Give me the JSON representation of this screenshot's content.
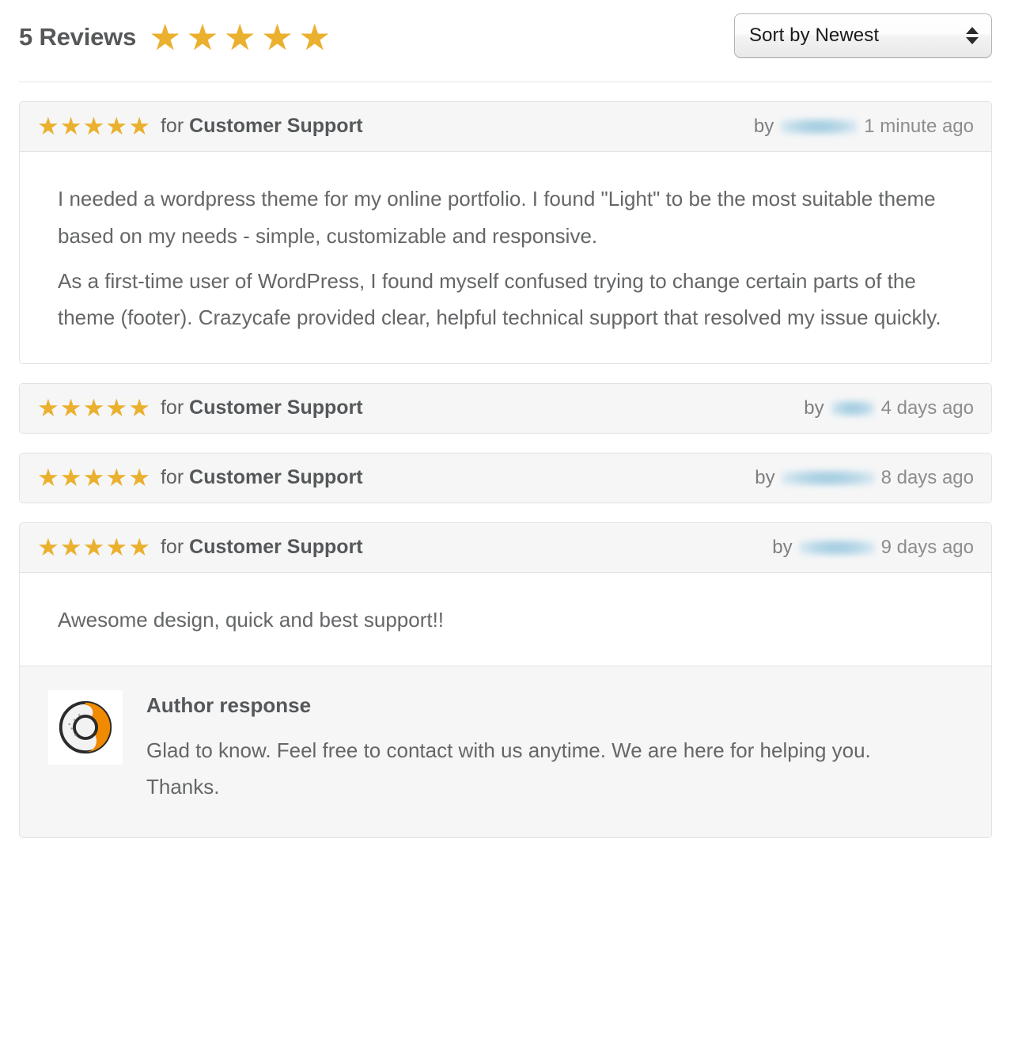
{
  "header": {
    "title": "5 Reviews",
    "rating_stars": 5,
    "star_glyph": "★",
    "star_color": "#eab02e"
  },
  "sort": {
    "label": "Sort by Newest",
    "options": [
      "Sort by Newest"
    ],
    "stepper_up_icon": "triangle-up-icon",
    "stepper_down_icon": "triangle-down-icon"
  },
  "reviews": [
    {
      "stars": 5,
      "for_label": "for",
      "subject": "Customer Support",
      "by_label": "by",
      "author_redacted": true,
      "author_redacted_width": 98,
      "date": "1 minute ago",
      "paragraphs": [
        "I needed a wordpress theme for my online portfolio. I found \"Light\" to be the most suitable theme based on my needs - simple, customizable and responsive.",
        "As a first-time user of WordPress, I found myself confused trying to change certain parts of the theme (footer). Crazycafe provided clear, helpful technical support that resolved my issue quickly."
      ],
      "author_response": null
    },
    {
      "stars": 5,
      "for_label": "for",
      "subject": "Customer Support",
      "by_label": "by",
      "author_redacted": true,
      "author_redacted_width": 56,
      "date": "4 days ago",
      "paragraphs": [],
      "author_response": null
    },
    {
      "stars": 5,
      "for_label": "for",
      "subject": "Customer Support",
      "by_label": "by",
      "author_redacted": true,
      "author_redacted_width": 118,
      "date": "8 days ago",
      "paragraphs": [],
      "author_response": null
    },
    {
      "stars": 5,
      "for_label": "for",
      "subject": "Customer Support",
      "by_label": "by",
      "author_redacted": true,
      "author_redacted_width": 96,
      "date": "9 days ago",
      "paragraphs": [
        "Awesome design, quick and best support!!"
      ],
      "author_response": {
        "title": "Author response",
        "text": "Glad to know. Feel free to contact with us anytime. We are here for helping you. Thanks.",
        "avatar_icon": "donut-logo-avatar"
      }
    }
  ]
}
